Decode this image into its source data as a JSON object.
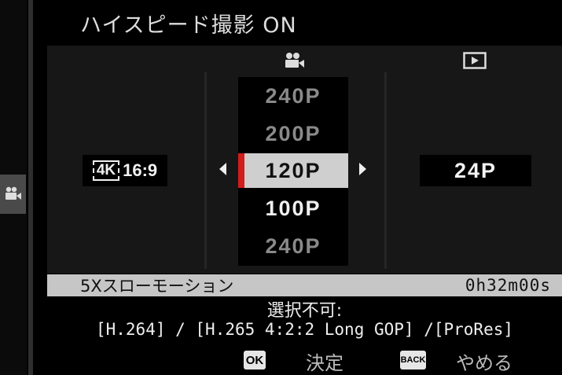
{
  "header": {
    "title": "ハイスピード撮影 ON"
  },
  "icons": {
    "left_tab": "movie-camera-icon",
    "column_movie": "movie-camera-icon",
    "column_playback": "playback-icon"
  },
  "recording": {
    "resolution_badge": "4K",
    "aspect": "16:9"
  },
  "wheel": {
    "items": [
      "240P",
      "200P",
      "120P",
      "100P",
      "240P"
    ],
    "selected_index": 2,
    "selected": "120P"
  },
  "playback": {
    "value": "24P"
  },
  "info_bar": {
    "label": "5Xスローモーション",
    "time": "0h32m00s"
  },
  "note": {
    "title": "選択不可:",
    "text": "[H.264] / [H.265 4:2:2 Long GOP] /[ProRes]"
  },
  "footer": {
    "ok_badge": "OK",
    "ok_label": "決定",
    "back_badge": "BACK",
    "back_label": "やめる"
  },
  "colors": {
    "background": "#000000",
    "panel": "#171717",
    "selected_row": "#cfcfcf",
    "selection_accent": "#d21d1d",
    "info_bar": "#c6c6c6"
  }
}
